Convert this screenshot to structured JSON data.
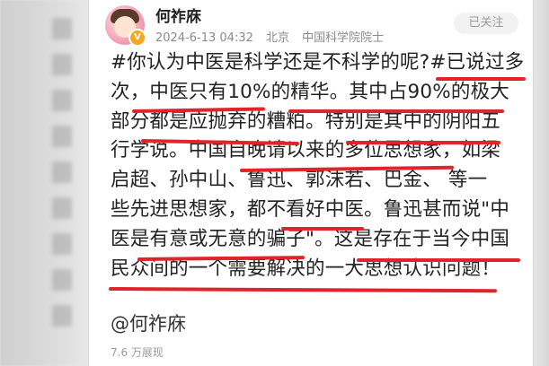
{
  "post": {
    "username": "何祚庥",
    "verified_badge": "V",
    "time": "2024-6-13 04:32",
    "location": "北京",
    "title": "中国科学院院士",
    "follow_label": "已关注",
    "lines": [
      "#你认为中医是科学还是不科学的呢?#已说过多",
      "次，中医只有10%的精华。其中占90%的极大",
      "部分都是应抛弃的糟粕。特别是其中的阴阳五",
      "行学说。中国自晚请以来的多位思想家，如梁",
      "启超、孙中山、鲁迅、郭沫若、巴金、    等一",
      "些先进思想家，都不看好中医。鲁迅甚而说\"中",
      "医是有意或无意的骗子\"。这是存在于当今中国",
      "民众间的一个需要解决的一大思想认识问题！"
    ],
    "mention": "@何祚庥",
    "views": "7.6 万展现"
  },
  "colors": {
    "underline": "#e0242a",
    "follow_text": "#9a9a9a",
    "meta_text": "#8a8a8a"
  }
}
